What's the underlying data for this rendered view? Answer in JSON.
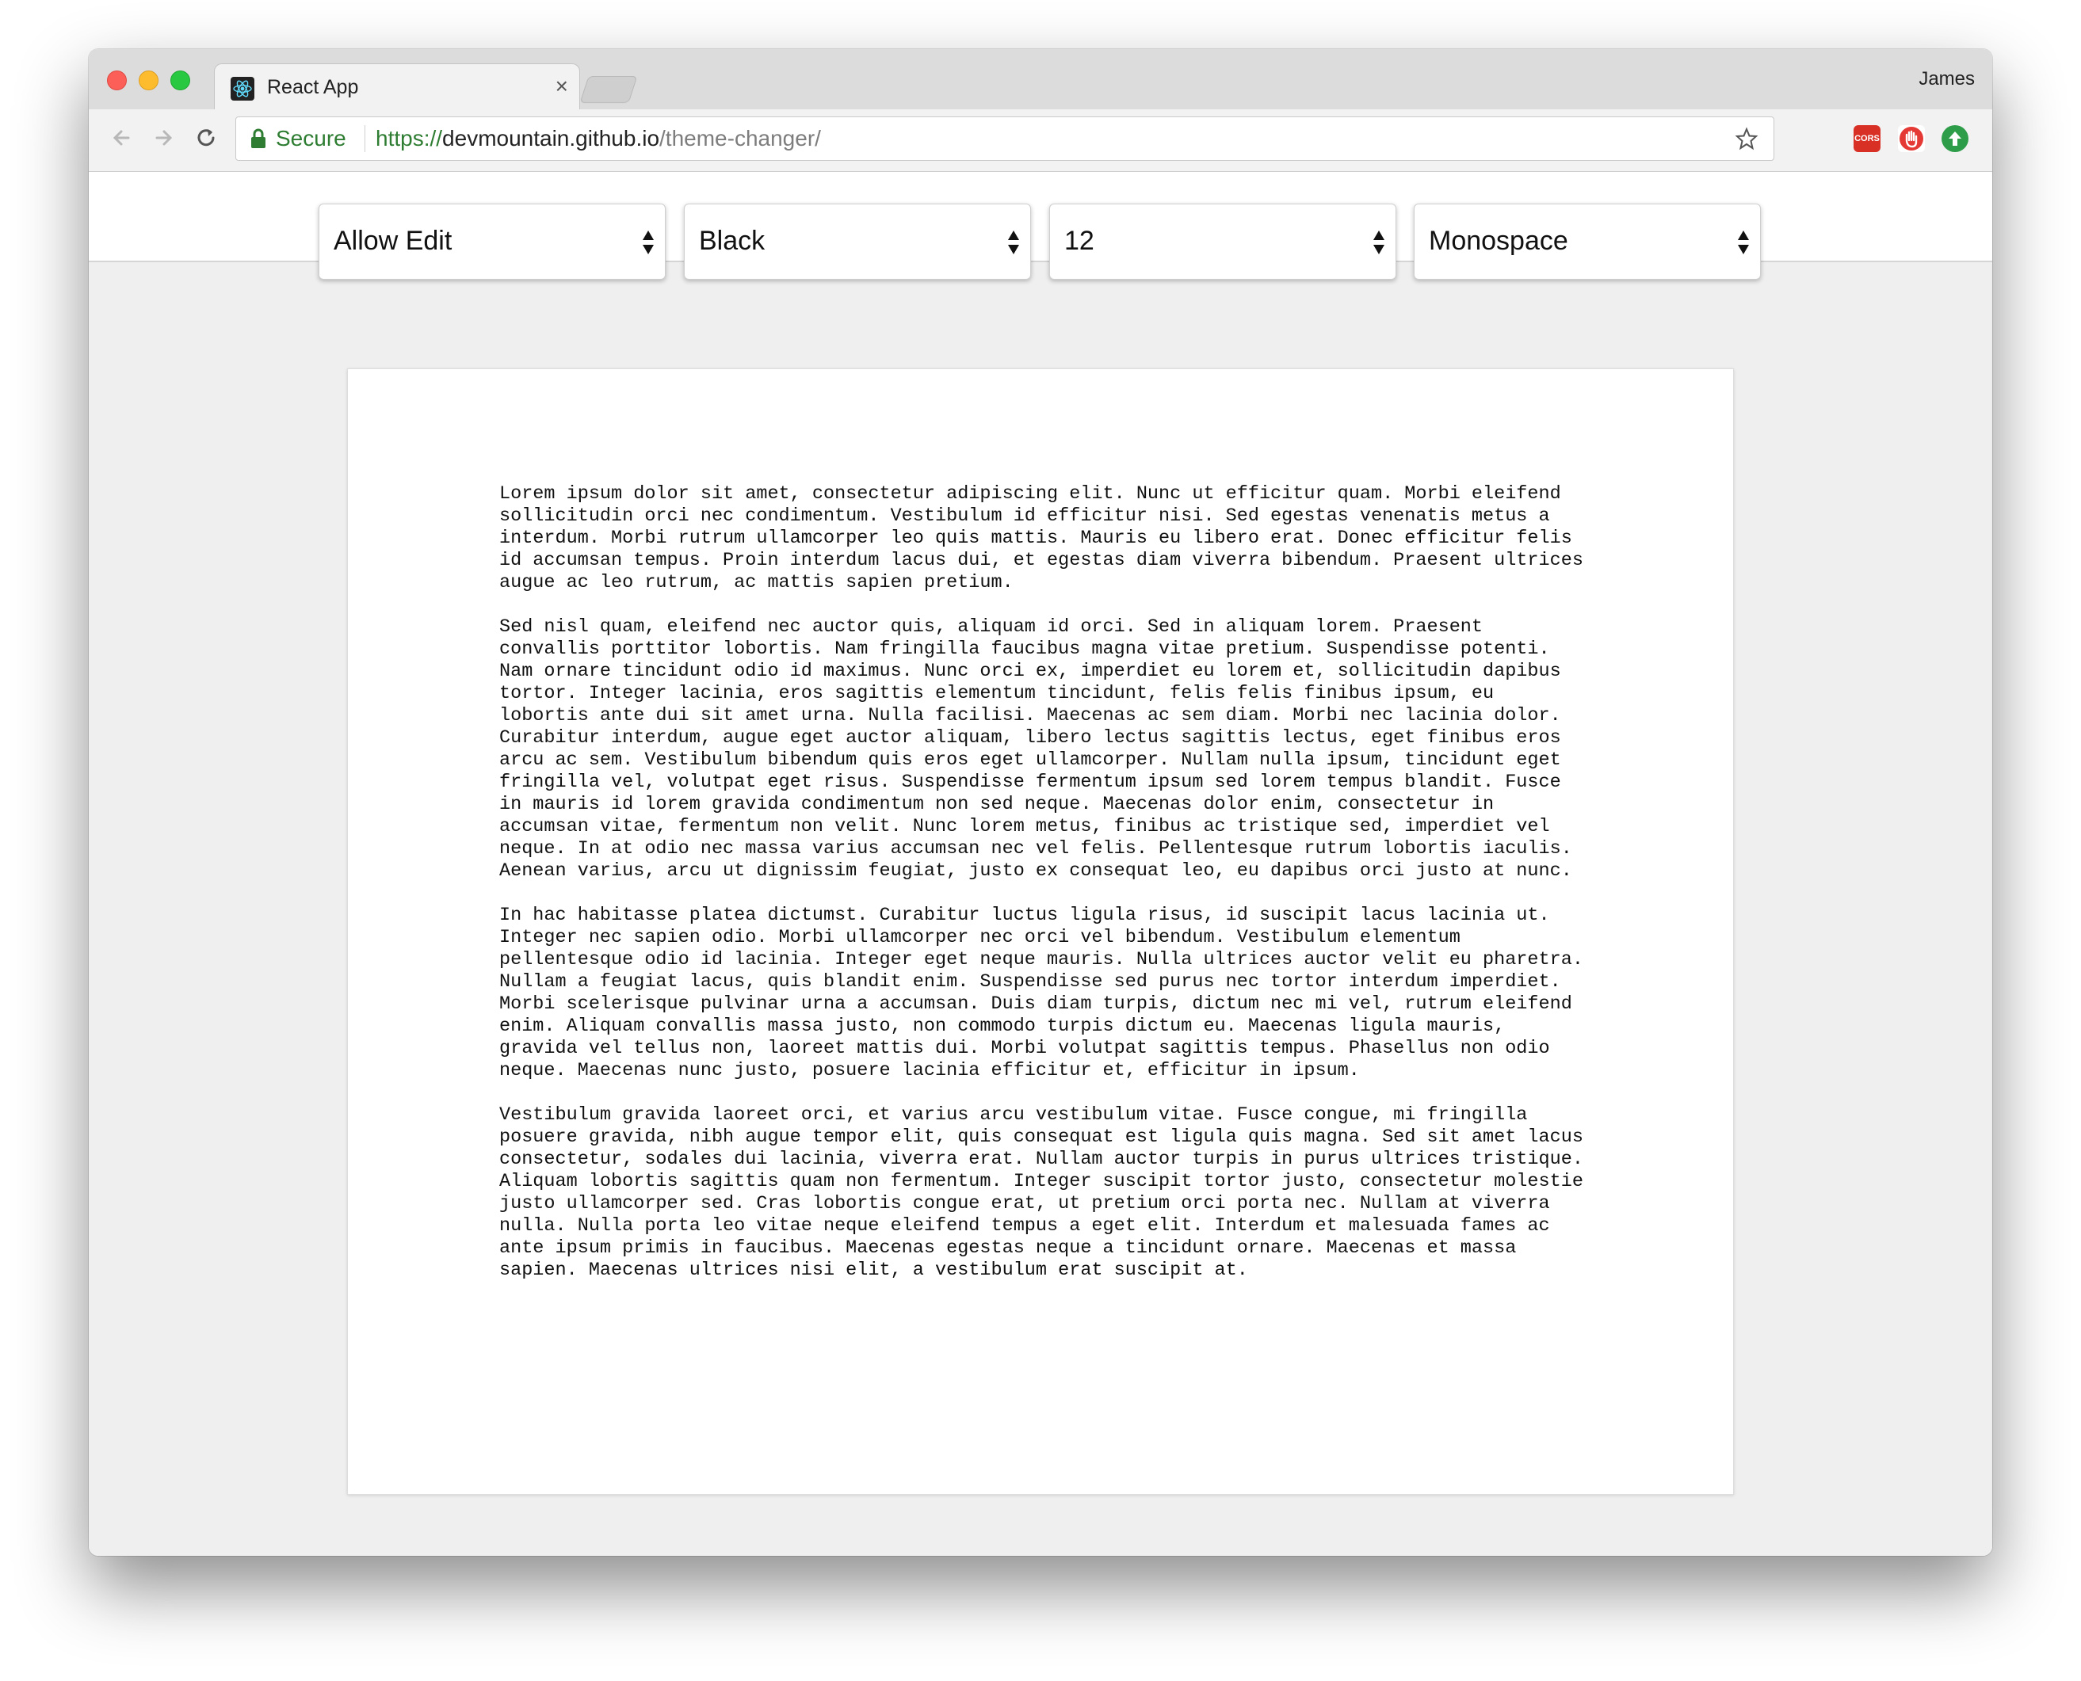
{
  "browser": {
    "tab_title": "React App",
    "tab_close": "×",
    "profile_name": "James",
    "secure_label": "Secure",
    "url_scheme": "https://",
    "url_host": "devmountain.github.io",
    "url_path": "/theme-changer/",
    "extensions": [
      "cors-extension-icon",
      "hand-extension-icon",
      "upload-extension-icon"
    ],
    "cors_label": "CORS"
  },
  "controls": {
    "edit_mode": "Allow Edit",
    "color": "Black",
    "font_size": "12",
    "font_family": "Monospace"
  },
  "content": {
    "paragraphs": [
      "Lorem ipsum dolor sit amet, consectetur adipiscing elit. Nunc ut efficitur quam. Morbi eleifend sollicitudin orci nec condimentum. Vestibulum id efficitur nisi. Sed egestas venenatis metus a interdum. Morbi rutrum ullamcorper leo quis mattis. Mauris eu libero erat. Donec efficitur felis id accumsan tempus. Proin interdum lacus dui, et egestas diam viverra bibendum. Praesent ultrices augue ac leo rutrum, ac mattis sapien pretium.",
      "Sed nisl quam, eleifend nec auctor quis, aliquam id orci. Sed in aliquam lorem. Praesent convallis porttitor lobortis. Nam fringilla faucibus magna vitae pretium. Suspendisse potenti. Nam ornare tincidunt odio id maximus. Nunc orci ex, imperdiet eu lorem et, sollicitudin dapibus tortor. Integer lacinia, eros sagittis elementum tincidunt, felis felis finibus ipsum, eu lobortis ante dui sit amet urna. Nulla facilisi. Maecenas ac sem diam. Morbi nec lacinia dolor. Curabitur interdum, augue eget auctor aliquam, libero lectus sagittis lectus, eget finibus eros arcu ac sem. Vestibulum bibendum quis eros eget ullamcorper. Nullam nulla ipsum, tincidunt eget fringilla vel, volutpat eget risus. Suspendisse fermentum ipsum sed lorem tempus blandit. Fusce in mauris id lorem gravida condimentum non sed neque. Maecenas dolor enim, consectetur in accumsan vitae, fermentum non velit. Nunc lorem metus, finibus ac tristique sed, imperdiet vel neque. In at odio nec massa varius accumsan nec vel felis. Pellentesque rutrum lobortis iaculis. Aenean varius, arcu ut dignissim feugiat, justo ex consequat leo, eu dapibus orci justo at nunc.",
      "In hac habitasse platea dictumst. Curabitur luctus ligula risus, id suscipit lacus lacinia ut. Integer nec sapien odio. Morbi ullamcorper nec orci vel bibendum. Vestibulum elementum pellentesque odio id lacinia. Integer eget neque mauris. Nulla ultrices auctor velit eu pharetra. Nullam a feugiat lacus, quis blandit enim. Suspendisse sed purus nec tortor interdum imperdiet. Morbi scelerisque pulvinar urna a accumsan. Duis diam turpis, dictum nec mi vel, rutrum eleifend enim. Aliquam convallis massa justo, non commodo turpis dictum eu. Maecenas ligula mauris, gravida vel tellus non, laoreet mattis dui. Morbi volutpat sagittis tempus. Phasellus non odio neque. Maecenas nunc justo, posuere lacinia efficitur et, efficitur in ipsum.",
      "Vestibulum gravida laoreet orci, et varius arcu vestibulum vitae. Fusce congue, mi fringilla posuere gravida, nibh augue tempor elit, quis consequat est ligula quis magna. Sed sit amet lacus consectetur, sodales dui lacinia, viverra erat. Nullam auctor turpis in purus ultrices tristique. Aliquam lobortis sagittis quam non fermentum. Integer suscipit tortor justo, consectetur molestie justo ullamcorper sed. Cras lobortis congue erat, ut pretium orci porta nec. Nullam at viverra nulla. Nulla porta leo vitae neque eleifend tempus a eget elit. Interdum et malesuada fames ac ante ipsum primis in faucibus. Maecenas egestas neque a tincidunt ornare. Maecenas et massa sapien. Maecenas ultrices nisi elit, a vestibulum erat suscipit at."
    ]
  },
  "colors": {
    "secure_green": "#2e7d32",
    "page_bg": "#efefef",
    "text": "#111111"
  }
}
